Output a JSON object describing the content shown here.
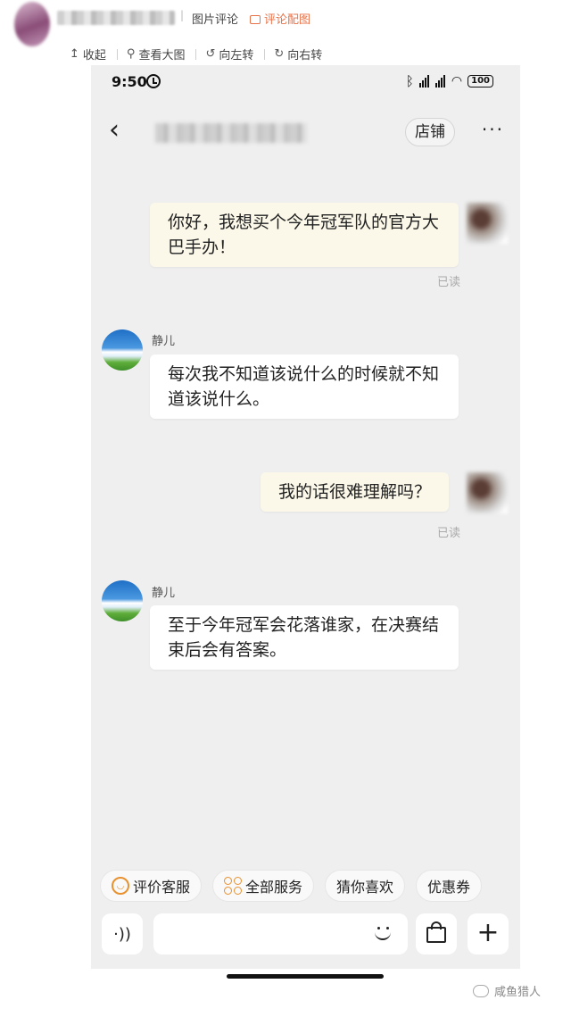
{
  "header": {
    "separator": "|",
    "tag": "图片评论",
    "link": "评论配图"
  },
  "toolbar": {
    "collapse": "收起",
    "view_large": "查看大图",
    "rotate_left": "向左转",
    "rotate_right": "向右转"
  },
  "status_bar": {
    "time": "9:50",
    "battery": "100"
  },
  "nav": {
    "back_icon": "‹",
    "store_button": "店铺",
    "more_icon": "···"
  },
  "messages": [
    {
      "from": "me",
      "text": "你好，我想买个今年冠军队的官方大巴手办！",
      "status": "已读"
    },
    {
      "from": "bot",
      "name": "静儿",
      "text": "每次我不知道该说什么的时候就不知道该说什么。"
    },
    {
      "from": "me",
      "text": "我的话很难理解吗？",
      "status": "已读"
    },
    {
      "from": "bot",
      "name": "静儿",
      "text": "至于今年冠军会花落谁家，在决赛结束后会有答案。"
    }
  ],
  "quick_actions": [
    "评价客服",
    "全部服务",
    "猜你喜欢",
    "优惠券"
  ],
  "input": {
    "plus": "+"
  },
  "watermark": "咸鱼猎人",
  "colors": {
    "accent": "#e8734a",
    "icon_orange": "#e8912f",
    "my_bubble": "#fbf8e9"
  }
}
